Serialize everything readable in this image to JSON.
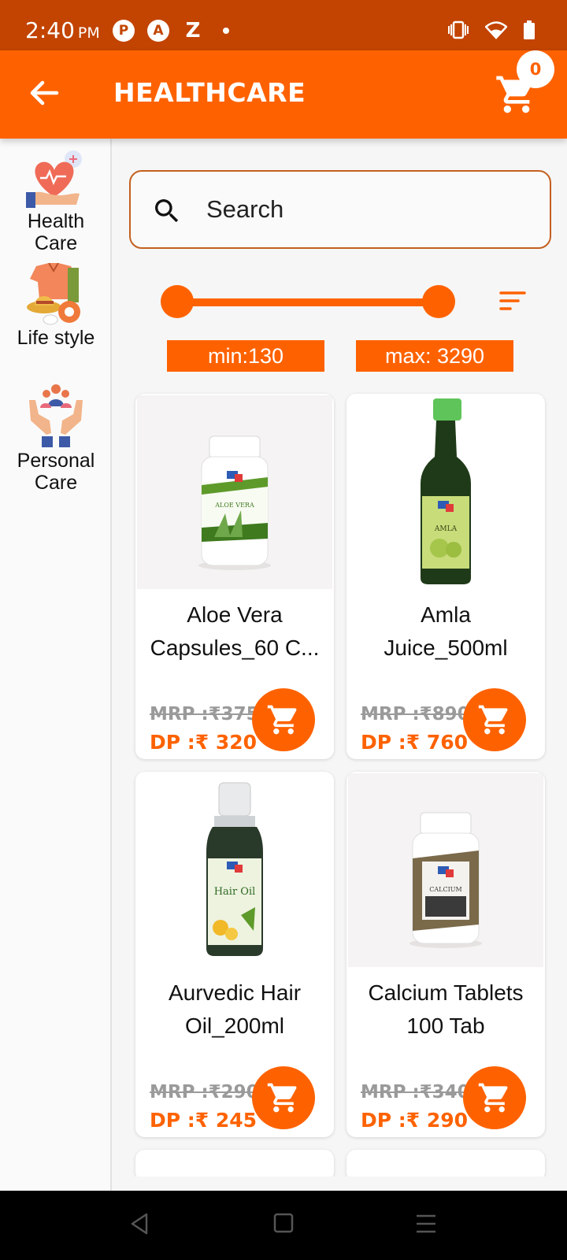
{
  "status_bar": {
    "time": "2:40",
    "ampm": "PM",
    "notif_letters": [
      "Z"
    ]
  },
  "app_bar": {
    "title": "HEALTHCARE",
    "cart_count": "0"
  },
  "sidebar": {
    "categories": [
      {
        "label_line1": "Health",
        "label_line2": "Care",
        "icon": "healthcare-icon"
      },
      {
        "label_line1": "Life style",
        "label_line2": "",
        "icon": "lifestyle-icon"
      },
      {
        "label_line1": "Personal",
        "label_line2": "Care",
        "icon": "personal-care-icon"
      }
    ]
  },
  "search": {
    "placeholder": "Search"
  },
  "price_filter": {
    "min_label": "min:130",
    "max_label": "max: 3290"
  },
  "products": [
    {
      "name_line1": "Aloe Vera",
      "name_line2": "Capsules_60 C...",
      "mrp": "MRP :₹375",
      "dp": "DP  :₹ 320"
    },
    {
      "name_line1": "Amla",
      "name_line2": "Juice_500ml",
      "mrp": "MRP :₹890",
      "dp": "DP  :₹ 760"
    },
    {
      "name_line1": "Aurvedic Hair",
      "name_line2": "Oil_200ml",
      "mrp": "MRP :₹290",
      "dp": "DP  :₹ 245"
    },
    {
      "name_line1": "Calcium Tablets",
      "name_line2": "100 Tab",
      "mrp": "MRP :₹340",
      "dp": "DP  :₹ 290"
    }
  ],
  "colors": {
    "primary": "#fe6200",
    "status_bar": "#c24400"
  }
}
